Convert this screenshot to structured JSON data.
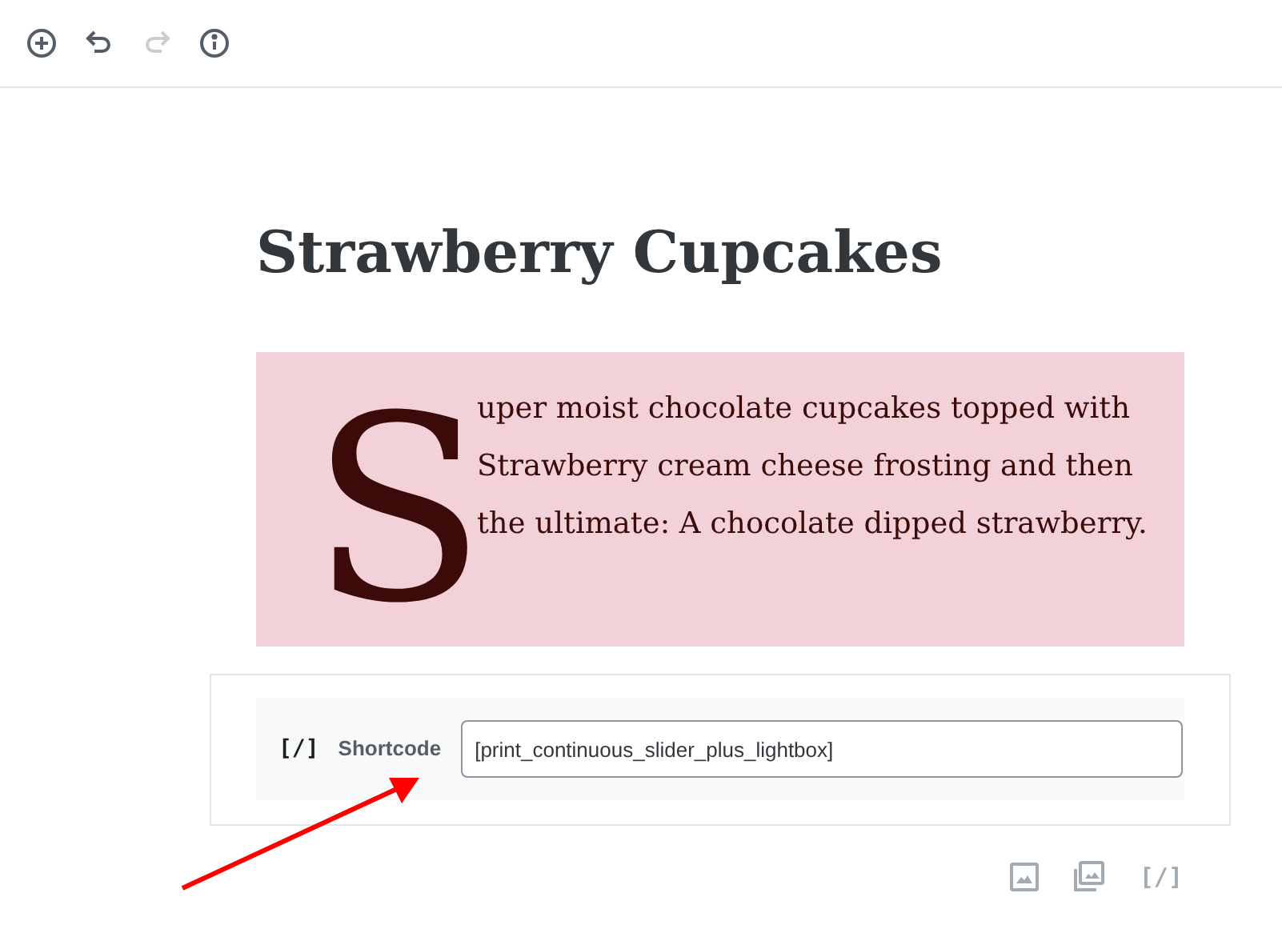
{
  "toolbar": [
    {
      "kind": "add",
      "disabled": false
    },
    {
      "kind": "undo",
      "disabled": false
    },
    {
      "kind": "redo",
      "disabled": true
    },
    {
      "kind": "info",
      "disabled": false
    }
  ],
  "post_title": "Strawberry Cupcakes",
  "paragraph": {
    "drop_cap": "S",
    "text": "uper moist chocolate cupcakes topped with Strawberry cream cheese frosting and then the ultimate: A chocolate dipped strawberry."
  },
  "shortcode_block": {
    "icon_text": "[/]",
    "label": "Shortcode",
    "value": "[print_continuous_slider_plus_lightbox]"
  },
  "inserter": [
    {
      "kind": "image"
    },
    {
      "kind": "gallery"
    },
    {
      "kind": "shortcode",
      "text": "[/]"
    }
  ]
}
